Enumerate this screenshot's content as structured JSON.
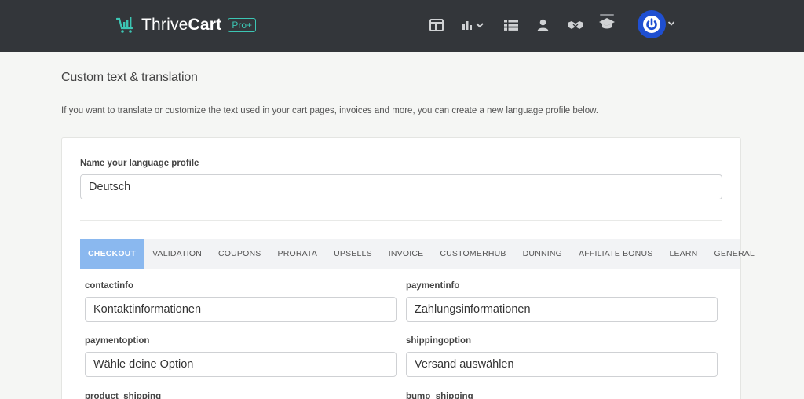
{
  "header": {
    "logo_text_a": "Thrive",
    "logo_text_b": "Cart",
    "logo_badge": "Pro+",
    "nav_icons": [
      "dashboard-icon",
      "analytics-icon",
      "products-icon",
      "user-icon",
      "affiliates-icon",
      "learn-icon"
    ]
  },
  "page": {
    "title": "Custom text & translation",
    "description": "If you want to translate or customize the text used in your cart pages, invoices and more, you can create a new language profile below."
  },
  "profile": {
    "name_label": "Name your language profile",
    "name_value": "Deutsch"
  },
  "tabs": [
    {
      "label": "CHECKOUT",
      "active": true
    },
    {
      "label": "VALIDATION"
    },
    {
      "label": "COUPONS"
    },
    {
      "label": "PRORATA"
    },
    {
      "label": "UPSELLS"
    },
    {
      "label": "INVOICE"
    },
    {
      "label": "CUSTOMERHUB"
    },
    {
      "label": "DUNNING"
    },
    {
      "label": "AFFILIATE BONUS"
    },
    {
      "label": "LEARN"
    },
    {
      "label": "GENERAL"
    }
  ],
  "fields": [
    {
      "key": "contactinfo",
      "value": "Kontaktinformationen"
    },
    {
      "key": "paymentinfo",
      "value": "Zahlungsinformationen"
    },
    {
      "key": "paymentoption",
      "value": "Wähle deine Option"
    },
    {
      "key": "shippingoption",
      "value": "Versand auswählen"
    },
    {
      "key": "product_shipping",
      "value": ""
    },
    {
      "key": "bump_shipping",
      "value": ""
    }
  ],
  "colors": {
    "topbar": "#33363a",
    "brand": "#3cc6b4",
    "avatar": "#1f4fd1",
    "active_tab": "#8ab8ef"
  }
}
